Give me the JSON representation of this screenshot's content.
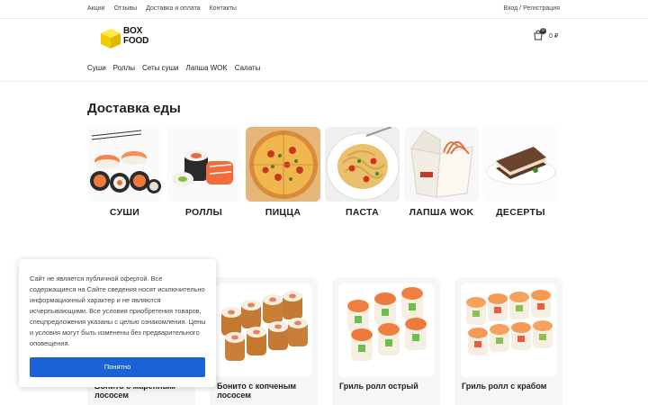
{
  "topbar": {
    "links": [
      "Акции",
      "Отзывы",
      "Доставка и оплата",
      "Контакты"
    ],
    "auth": "Вход / Регистрация"
  },
  "logo": {
    "line1": "BOX",
    "line2": "FOOD",
    "color": "#f6d600"
  },
  "cart": {
    "count": "0",
    "sum": "0 ₽"
  },
  "menu": [
    "Суши",
    "Роллы",
    "Сеты суши",
    "Лапша WOK",
    "Салаты"
  ],
  "categories": {
    "title": "Доставка еды",
    "items": [
      {
        "label": "СУШИ",
        "icon": "sushi-image"
      },
      {
        "label": "РОЛЛЫ",
        "icon": "rolls-image"
      },
      {
        "label": "ПИЦЦА",
        "icon": "pizza-image"
      },
      {
        "label": "ПАСТА",
        "icon": "pasta-image"
      },
      {
        "label": "ЛАПША WOK",
        "icon": "wok-noodles-image"
      },
      {
        "label": "ДЕСЕРТЫ",
        "icon": "dessert-image"
      }
    ]
  },
  "products": {
    "items": [
      {
        "name": "Бонито с жаренным лососем"
      },
      {
        "name": "Бонито с копченым лососем"
      },
      {
        "name": "Гриль ролл острый"
      },
      {
        "name": "Гриль ролл с крабом"
      }
    ]
  },
  "cookie": {
    "text": "Сайт не является публичной офертой. Все содержащиеся на Сайте сведения носят исключительно информационный характер и не являются исчерпывающими. Все условия приобретения товаров, спецпредложения указаны с целью ознакомления. Цены и условия могут быть изменены без предварительного оповещения.",
    "button": "Понятно",
    "button_color": "#1a62d8"
  }
}
